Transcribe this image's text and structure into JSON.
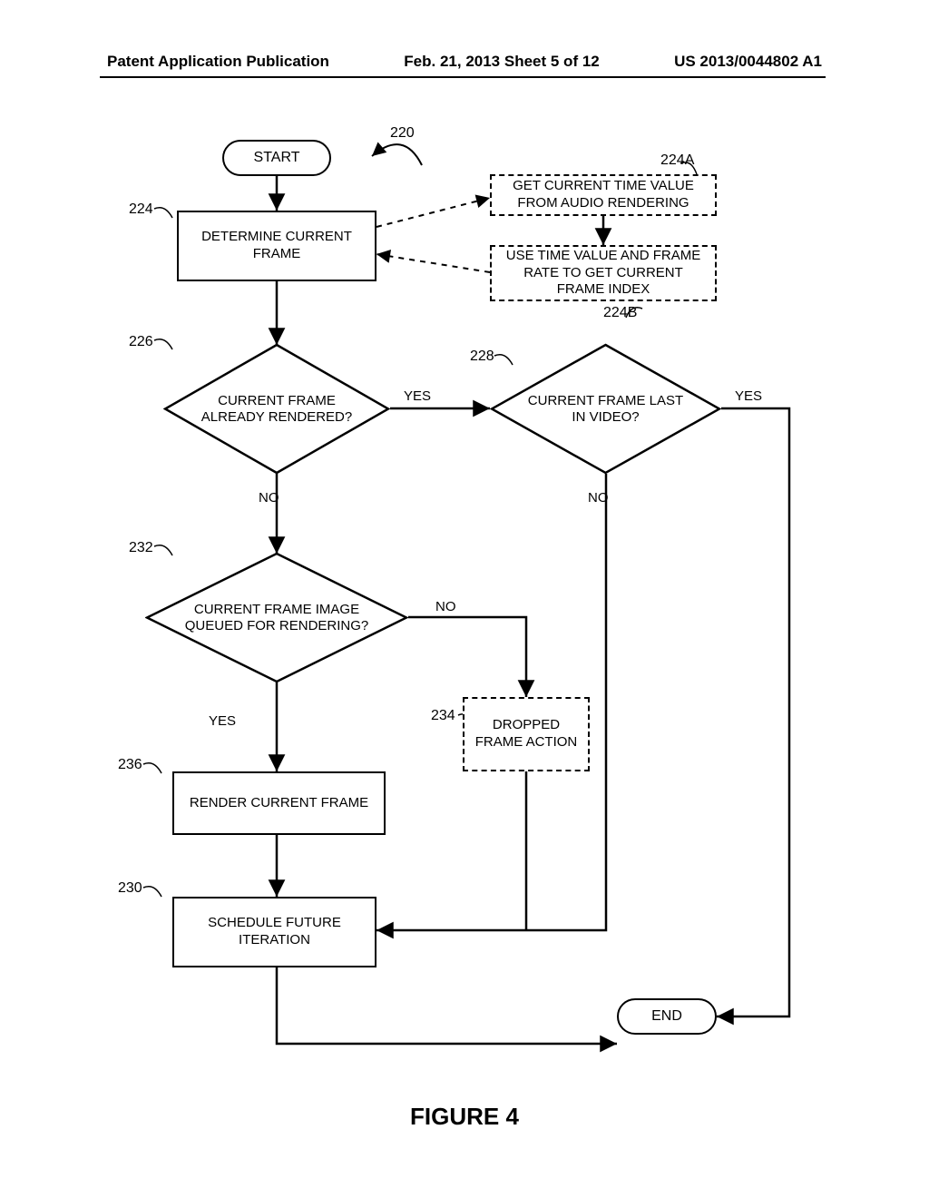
{
  "header": {
    "left": "Patent Application Publication",
    "center": "Feb. 21, 2013  Sheet 5 of 12",
    "right": "US 2013/0044802 A1"
  },
  "figure_caption": "FIGURE 4",
  "refs": {
    "r220": "220",
    "r224": "224",
    "r224A": "224A",
    "r224B": "224B",
    "r226": "226",
    "r228": "228",
    "r230": "230",
    "r232": "232",
    "r234": "234",
    "r236": "236"
  },
  "nodes": {
    "start": "START",
    "end": "END",
    "determine": "DETERMINE CURRENT FRAME",
    "getTime": "GET CURRENT TIME VALUE FROM AUDIO RENDERING",
    "useTime": "USE TIME VALUE AND FRAME RATE TO GET CURRENT FRAME INDEX",
    "dec226": "CURRENT FRAME ALREADY RENDERED?",
    "dec228": "CURRENT FRAME LAST IN VIDEO?",
    "dec232": "CURRENT FRAME IMAGE QUEUED FOR RENDERING?",
    "dropped": "DROPPED FRAME ACTION",
    "render": "RENDER CURRENT FRAME",
    "schedule": "SCHEDULE FUTURE ITERATION"
  },
  "edges": {
    "yes": "YES",
    "no": "NO"
  }
}
